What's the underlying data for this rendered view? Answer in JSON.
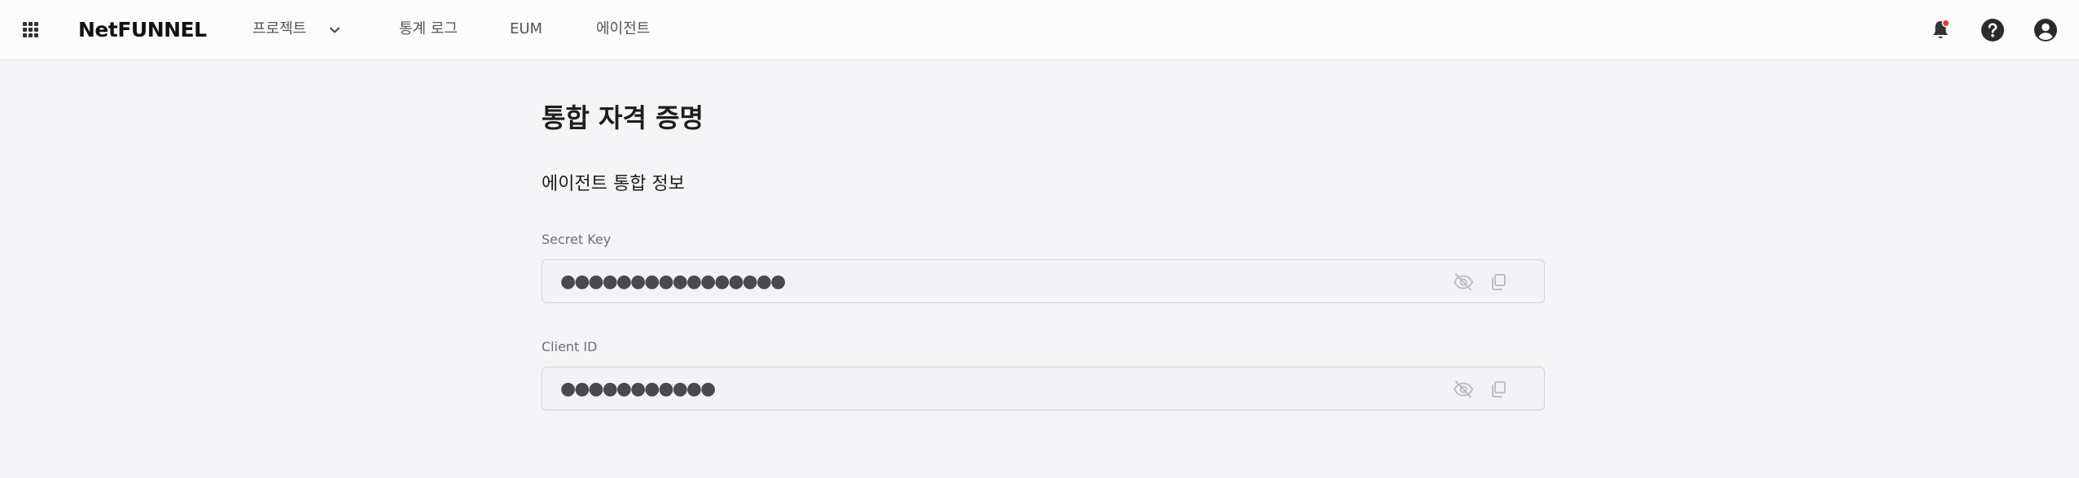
{
  "header": {
    "logo": "NetFUNNEL",
    "nav": [
      {
        "label": "프로젝트"
      },
      {
        "label": "통계 로그"
      },
      {
        "label": "EUM"
      },
      {
        "label": "에이전트"
      }
    ],
    "icons": [
      "apps-grid-icon",
      "chevron-down-icon",
      "bell-icon",
      "help-icon",
      "account-icon"
    ],
    "notification_dot_color": "#e53935"
  },
  "page": {
    "title": "통합 자격 증명",
    "section_title": "에이전트 통합 정보",
    "fields": [
      {
        "label": "Secret Key",
        "value": "●●●●●●●●●●●●●●●●"
      },
      {
        "label": "Client ID",
        "value": "●●●●●●●●●●●"
      }
    ]
  },
  "colors": {
    "background": "#f5f5f7",
    "header_bg": "#fcfcfc",
    "text": "#222222",
    "muted": "#6f6f73",
    "field_border": "#d4d4d8"
  }
}
